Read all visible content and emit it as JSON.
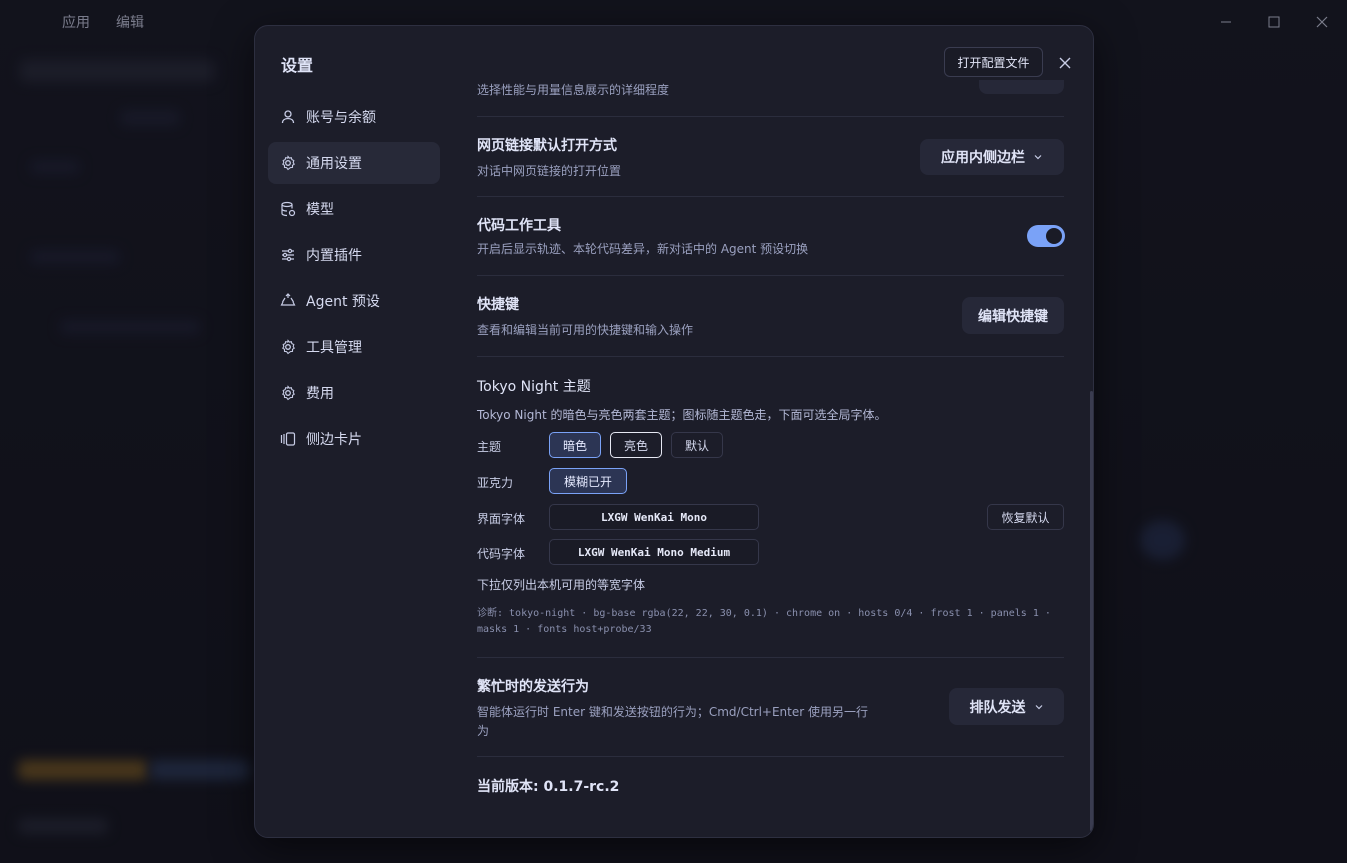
{
  "menubar": {
    "app": "应用",
    "edit": "编辑"
  },
  "modal": {
    "title": "设置",
    "open_config": "打开配置文件"
  },
  "sidebar": {
    "items": [
      {
        "label": "账号与余额",
        "icon": "user-icon"
      },
      {
        "label": "通用设置",
        "icon": "gear-icon"
      },
      {
        "label": "模型",
        "icon": "database-icon"
      },
      {
        "label": "内置插件",
        "icon": "sliders-icon"
      },
      {
        "label": "Agent 预设",
        "icon": "recycle-icon"
      },
      {
        "label": "工具管理",
        "icon": "gear-icon"
      },
      {
        "label": "费用",
        "icon": "gear-icon"
      },
      {
        "label": "侧边卡片",
        "icon": "cards-icon"
      }
    ],
    "active": "通用设置"
  },
  "settings": {
    "perf_desc": "选择性能与用量信息展示的详细程度",
    "link_open": {
      "title": "网页链接默认打开方式",
      "desc": "对话中网页链接的打开位置",
      "value": "应用内侧边栏"
    },
    "code_tools": {
      "title": "代码工作工具",
      "desc": "开启后显示轨迹、本轮代码差异，新对话中的 Agent 预设切换",
      "enabled": true
    },
    "shortcuts": {
      "title": "快捷键",
      "desc": "查看和编辑当前可用的快捷键和输入操作",
      "button": "编辑快捷键"
    },
    "theme": {
      "title": "Tokyo Night 主题",
      "desc": "Tokyo Night 的暗色与亮色两套主题；图标随主题色走，下面可选全局字体。",
      "theme_label": "主题",
      "options": [
        "暗色",
        "亮色",
        "默认"
      ],
      "acrylic_label": "亚克力",
      "acrylic_value": "模糊已开",
      "ui_font_label": "界面字体",
      "ui_font": "LXGW WenKai Mono",
      "reset": "恢复默认",
      "code_font_label": "代码字体",
      "code_font": "LXGW WenKai Mono Medium",
      "mono_note": "下拉仅列出本机可用的等宽字体",
      "diag_line1": "诊断: tokyo-night · bg-base rgba(22, 22, 30, 0.1) · chrome on · hosts 0/4 · frost 1 · panels 1 ·",
      "diag_line2": "masks 1 · fonts host+probe/33"
    },
    "busy_send": {
      "title": "繁忙时的发送行为",
      "desc_line1": "智能体运行时 Enter 键和发送按钮的行为；Cmd/Ctrl+Enter 使用另一行",
      "desc_line2": "为",
      "value": "排队发送"
    },
    "version": "当前版本: 0.1.7-rc.2"
  },
  "colors": {
    "accent": "#7aa2f7",
    "modal_bg": "#1c1d29",
    "panel": "#262838"
  }
}
